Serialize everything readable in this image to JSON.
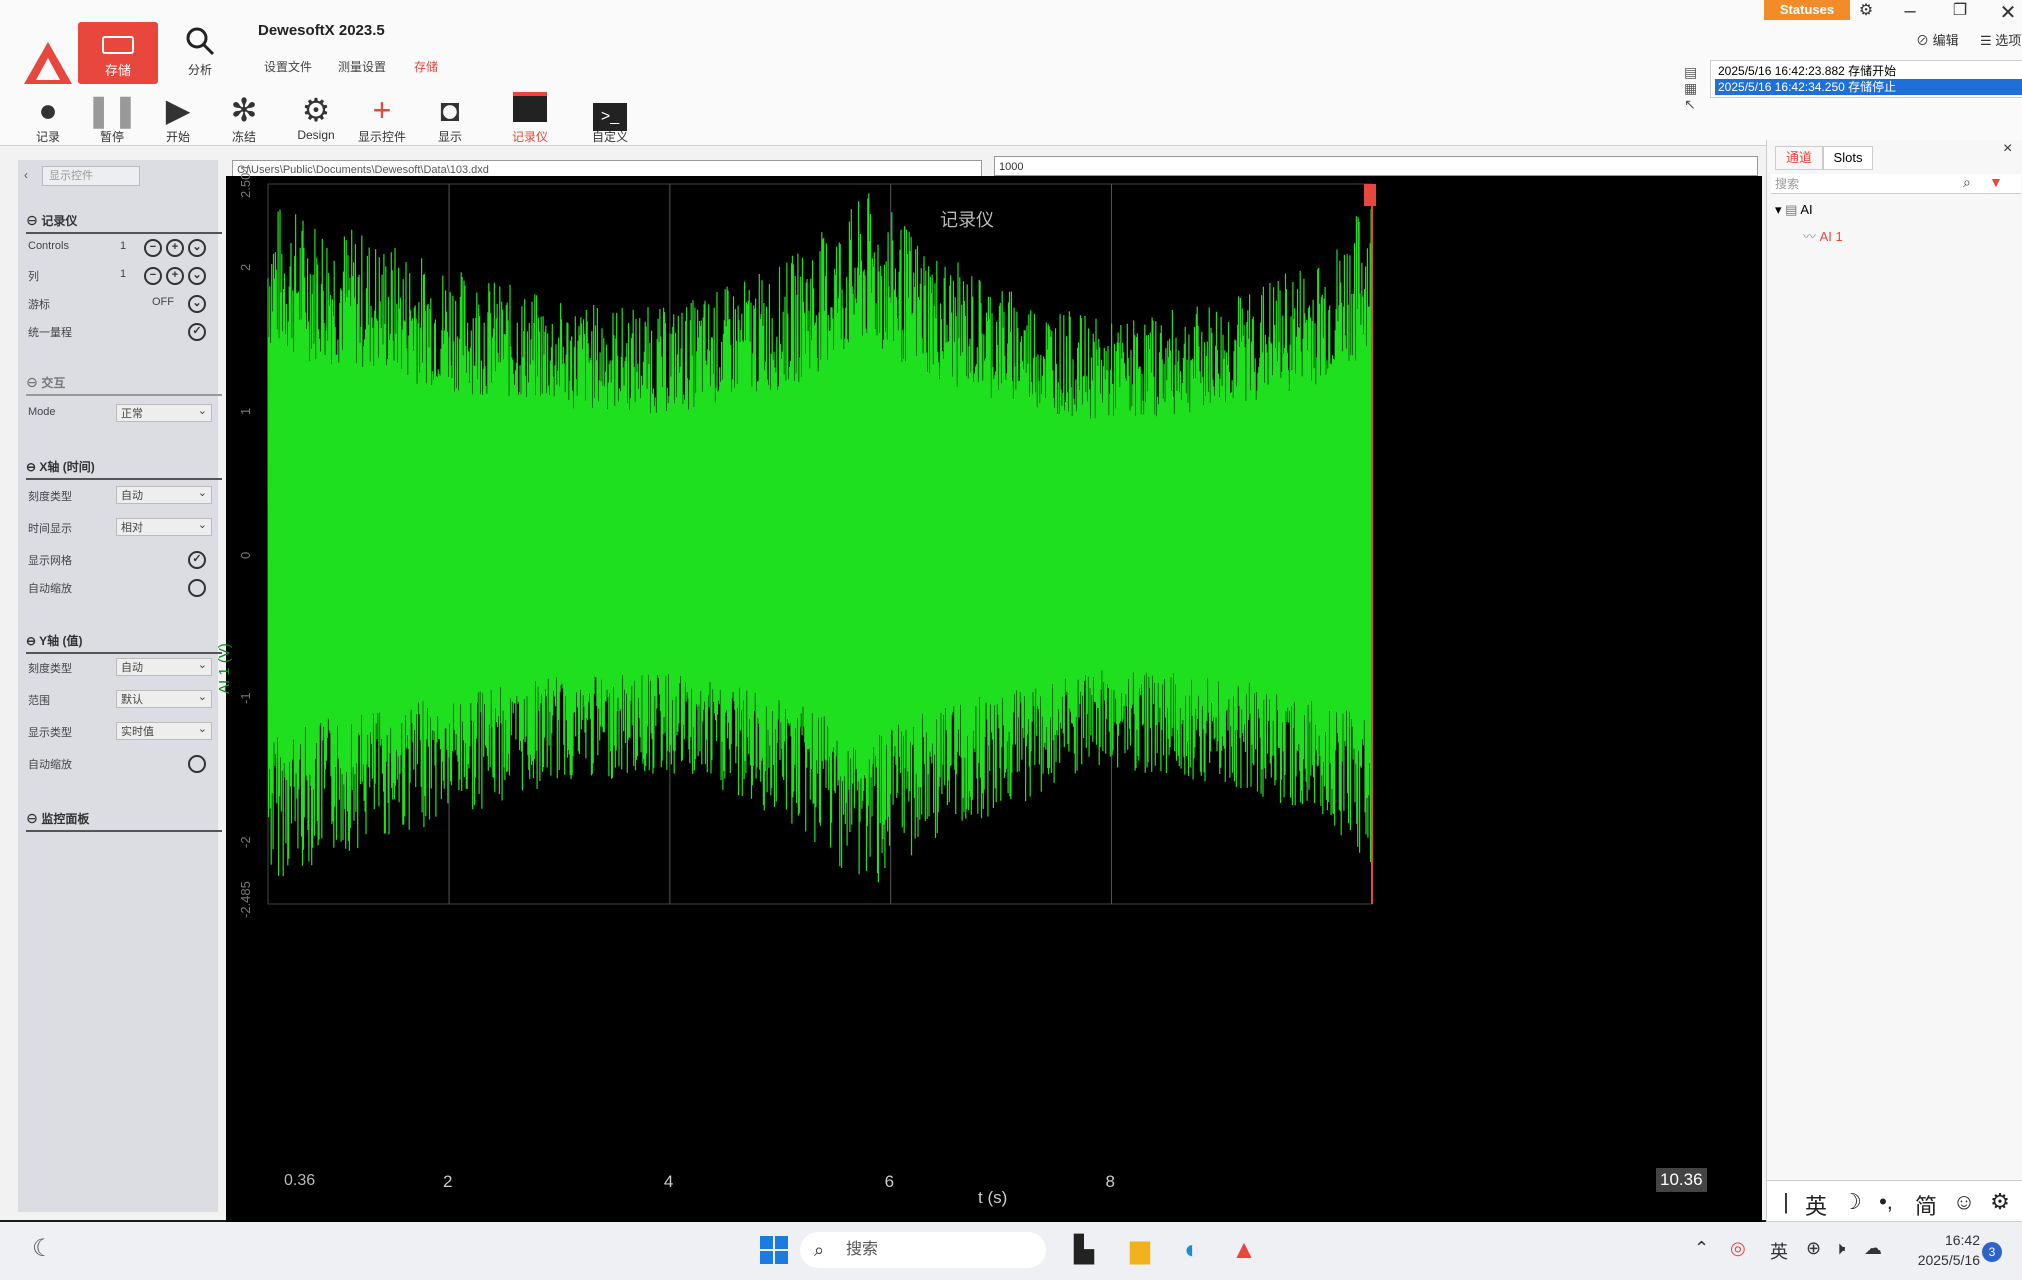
{
  "app": {
    "title": "DewesoftX 2023.5",
    "store_label": "存储",
    "analyze_label": "分析",
    "menu": [
      "设置文件",
      "测量设置",
      "存储"
    ]
  },
  "toolbar": [
    {
      "label": "记录",
      "icon": "record-icon"
    },
    {
      "label": "暂停",
      "icon": "pause-icon"
    },
    {
      "label": "开始",
      "icon": "play-icon"
    },
    {
      "label": "冻结",
      "icon": "freeze-icon"
    },
    {
      "label": "Design",
      "icon": "gear-icon"
    },
    {
      "label": "显示控件",
      "icon": "add-widget-icon"
    },
    {
      "label": "显示",
      "icon": "display-icon"
    },
    {
      "label": "记录仪",
      "icon": "recorder-icon"
    },
    {
      "label": "自定义",
      "icon": "terminal-icon"
    }
  ],
  "topright": {
    "statuses": "Statuses",
    "edit": "编辑",
    "options": "选项",
    "events": [
      "2025/5/16 16:42:23.882 存储开始",
      "2025/5/16 16:42:34.250 存储停止"
    ]
  },
  "left_panel": {
    "tab": "显示控件",
    "sections": {
      "recorder": "记录仪",
      "cursor": "交互",
      "x_axis": "X轴 (时间)",
      "y_axis": "Y轴 (值)",
      "monitor": "监控面板"
    },
    "rows": {
      "controls": {
        "label": "Controls",
        "value": "1"
      },
      "row2": {
        "label": "列",
        "value": "1"
      },
      "toggle": {
        "label": "游标",
        "value": "OFF"
      },
      "same": {
        "label": "统一量程"
      },
      "mode": {
        "label": "Mode",
        "value": "正常"
      },
      "x_scale_type": {
        "label": "刻度类型",
        "value": "自动"
      },
      "x_display": {
        "label": "时间显示",
        "value": "相对"
      },
      "x_check": {
        "label": "显示网格"
      },
      "x_auto": {
        "label": "自动缩放"
      },
      "y_scale_type": {
        "label": "刻度类型",
        "value": "自动"
      },
      "y_range": {
        "label": "范围",
        "value": "默认"
      },
      "y_display": {
        "label": "显示类型",
        "value": "实时值"
      },
      "y_auto": {
        "label": "自动缩放"
      }
    }
  },
  "file_path": "C:\\Users\\Public\\Documents\\Dewesoft\\Data\\103.dxd",
  "value_box": "1000",
  "chart_data": {
    "type": "line",
    "title": "记录仪",
    "xlabel": "t (s)",
    "ylabel": "AI 1 (V)",
    "xlim": [
      0.36,
      10.36
    ],
    "ylim": [
      -2.485,
      2.504
    ],
    "x_ticks": [
      "2",
      "4",
      "6",
      "8"
    ],
    "x_start_label": "0.36",
    "x_end_label": "10.36",
    "y_ticks": [
      "2.504",
      "2",
      "1",
      "0",
      "-1",
      "-2",
      "-2.485"
    ],
    "series": [
      {
        "name": "AI 1",
        "color": "#1ee01e",
        "envelope_x": [
          0.36,
          1.0,
          2.0,
          3.0,
          4.0,
          5.0,
          5.8,
          6.5,
          7.5,
          8.0,
          9.0,
          10.0,
          10.36
        ],
        "envelope_upper": [
          2.4,
          2.25,
          1.95,
          1.7,
          1.65,
          1.95,
          2.45,
          2.0,
          1.65,
          1.55,
          1.7,
          2.05,
          2.45
        ],
        "envelope_lower": [
          -2.35,
          -2.15,
          -1.9,
          -1.65,
          -1.6,
          -1.9,
          -2.4,
          -2.0,
          -1.7,
          -1.55,
          -1.65,
          -1.95,
          -2.25
        ]
      }
    ],
    "grid": true,
    "legend": "none"
  },
  "right_panel": {
    "tabs": [
      "通道",
      "Slots"
    ],
    "search_placeholder": "搜索",
    "tree_group": "AI",
    "tree_item": "AI 1"
  },
  "ime": [
    "英",
    "简"
  ],
  "taskbar": {
    "search": "搜索",
    "tray_lang": "英",
    "time": "16:42",
    "date": "2025/5/16",
    "badge": "3"
  },
  "colors": {
    "accent": "#e8473e",
    "signal": "#1ee01e",
    "statuses": "#f28c28",
    "selection": "#1f6fd8"
  }
}
